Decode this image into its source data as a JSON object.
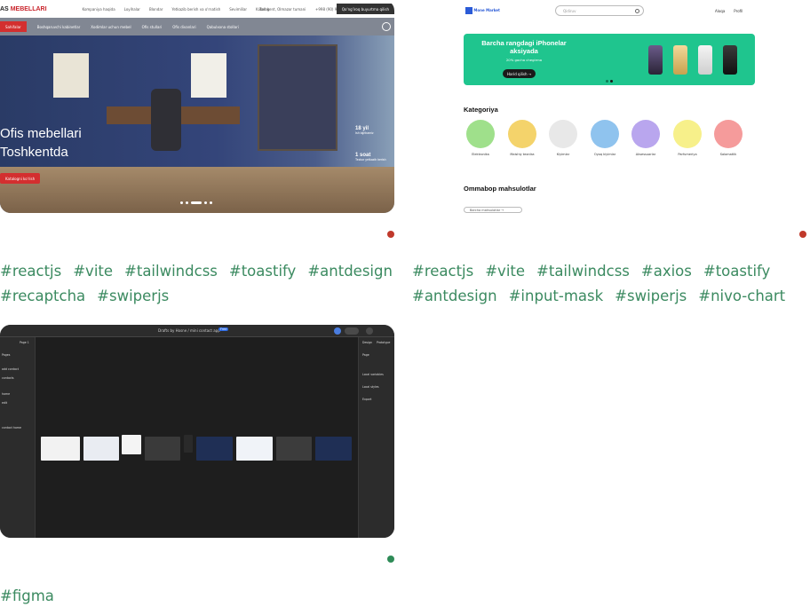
{
  "projects": [
    {
      "id_label": "card-furniture",
      "preview": {
        "logo_prefix": "AS",
        "logo_accent": "MEBELLARI",
        "nav": [
          "Kompaniya haqida",
          "Loyihalar",
          "Blondar",
          "Yetkazib berish va o'rnatish",
          "Sevimlilar",
          "Katalog"
        ],
        "address": "Toshkent, Olmazor tumani",
        "phone": "+998 (90) 999-99-99",
        "request_button": "Qo'ng'iroq buyurtma qilish",
        "menu": [
          "Sahifalar",
          "Boshqaruvchi kabinetlar",
          "Xodimlar uchun mebel",
          "Ofis stullari",
          "Ofis divanlari",
          "Qabulxona stollari"
        ],
        "hero_line1": "Ofis mebellari",
        "hero_line2": "Toshkentda",
        "cta": "Katalogni ko'rish",
        "stat1_value": "18 yil",
        "stat1_text": "Ish tajribamiz",
        "stat2_value": "1 soat",
        "stat2_text": "Tezkor yetkazib berish"
      },
      "status_color": "#c0392b",
      "tags": [
        "#reactjs",
        "#vite",
        "#tailwindcss",
        "#toastify",
        "#antdesign",
        "#recaptcha",
        "#swiperjs"
      ]
    },
    {
      "id_label": "card-market",
      "preview": {
        "logo": "Mone Market",
        "search_placeholder": "Qidiruv",
        "link_contact": "Aloqa",
        "link_profile": "Profil",
        "banner_title": "Barcha rangdagi iPhonelar aksiyada",
        "banner_sub": "20% gacha chegirma",
        "banner_button": "Harid qilish →",
        "categories_title": "Kategoriya",
        "categories": [
          "Elektronika",
          "Maishiy texnika",
          "Kiyimlar",
          "Oyoq kiyimlar",
          "Aksessuarlar",
          "Parfumeriya",
          "Salomatlik"
        ],
        "popular_title": "Ommabop mahsulotlar",
        "more_button": "Barcha mahsulotlar →"
      },
      "status_color": "#c0392b",
      "tags": [
        "#reactjs",
        "#vite",
        "#tailwindcss",
        "#axios",
        "#toastify",
        "#antdesign",
        "#input-mask",
        "#swiperjs",
        "#nivo-chart"
      ]
    },
    {
      "id_label": "card-figma",
      "preview": {
        "breadcrumb": "Drafts by Hosne / mini contact app",
        "badge": "Free",
        "page_label": "Page 1",
        "left_items": [
          "Pages",
          "Page 1",
          "Layers",
          "add contact",
          "contacts",
          "home",
          "edit",
          "contact home"
        ],
        "right_tabs": [
          "Design",
          "Prototype"
        ],
        "right_items": [
          "Page",
          "Local variables",
          "Local styles",
          "Export"
        ]
      },
      "status_color": "#2e8b57",
      "tags": [
        "#figma"
      ]
    }
  ],
  "colors": {
    "tag": "#3b8a60",
    "red_dot": "#c0392b",
    "green_dot": "#2e8b57",
    "banner": "#1fc58e"
  }
}
